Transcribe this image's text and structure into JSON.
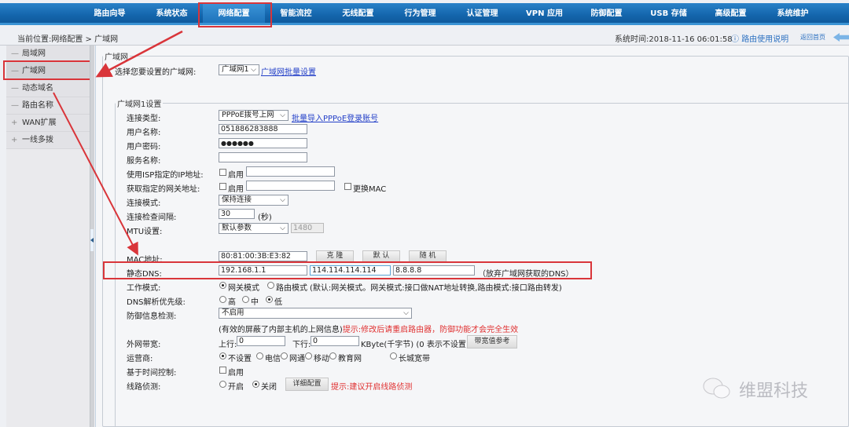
{
  "nav": {
    "items": [
      {
        "label": "路由向导"
      },
      {
        "label": "系统状态"
      },
      {
        "label": "网络配置",
        "active": true
      },
      {
        "label": "智能流控"
      },
      {
        "label": "无线配置"
      },
      {
        "label": "行为管理"
      },
      {
        "label": "认证管理"
      },
      {
        "label": "VPN 应用"
      },
      {
        "label": "防御配置"
      },
      {
        "label": "USB 存储"
      },
      {
        "label": "高级配置"
      },
      {
        "label": "系统维护"
      }
    ]
  },
  "infobar": {
    "breadcrumb": "当前位置:网络配置 > 广域网",
    "system_time": "系统时间:2018-11-16 06:01:58",
    "help_icon": "question-circle-icon",
    "help_link": "路由使用说明",
    "home_link": "返回首页"
  },
  "sidebar": {
    "items": [
      {
        "symbol": "—",
        "label": "局域网"
      },
      {
        "symbol": "—",
        "label": "广域网",
        "selected": true
      },
      {
        "symbol": "—",
        "label": "动态域名"
      },
      {
        "symbol": "—",
        "label": "路由名称"
      },
      {
        "symbol": "+",
        "label": "WAN扩展"
      },
      {
        "symbol": "+",
        "label": "一线多拨"
      }
    ]
  },
  "wan": {
    "legend": "广域网",
    "select_label": "选择您要设置的广域网:",
    "select_value": "广域网1",
    "batch_link": "广域网批量设置"
  },
  "wan1": {
    "legend": "广域网1设置",
    "conn_type": {
      "label": "连接类型:",
      "value": "PPPoE拨号上网",
      "link": "批量导入PPPoE登录账号"
    },
    "username": {
      "label": "用户名称:",
      "value": "051886283888"
    },
    "password": {
      "label": "用户密码:",
      "value": "●●●●●●"
    },
    "service": {
      "label": "服务名称:",
      "value": ""
    },
    "isp_ip": {
      "label": "使用ISP指定的IP地址:",
      "checkbox_label": "启用",
      "checked": false,
      "value": ""
    },
    "gateway": {
      "label": "获取指定的网关地址:",
      "checkbox_label": "启用",
      "checked": false,
      "value": "",
      "mac_checkbox_label": "更换MAC",
      "mac_checked": false
    },
    "conn_mode": {
      "label": "连接模式:",
      "value": "保持连接"
    },
    "check_interval": {
      "label": "连接检查间隔:",
      "value": "30",
      "unit": "(秒)"
    },
    "mtu": {
      "label": "MTU设置:",
      "value": "默认参数",
      "number": "1480"
    },
    "mac": {
      "label": "MAC地址:",
      "value": "80:81:00:3B:E3:82",
      "buttons": [
        "克 隆",
        "默 认",
        "随 机"
      ]
    },
    "dns": {
      "label": "静态DNS:",
      "values": [
        "192.168.1.1",
        "114.114.114.114",
        "8.8.8.8"
      ],
      "note": "（放弃广域网获取的DNS）"
    },
    "work_mode": {
      "label": "工作模式:",
      "options": [
        "网关模式",
        "路由模式"
      ],
      "selected": 0,
      "note": "(默认:网关模式。网关模式:接口做NAT地址转换,路由模式:接口路由转发)"
    },
    "dns_priority": {
      "label": "DNS解析优先级:",
      "options": [
        "高",
        "中",
        "低"
      ],
      "selected": 2
    },
    "defense": {
      "label": "防御信息检测:",
      "value": "不启用",
      "note": "(有效的屏蔽了内部主机的上网信息)",
      "warning": "提示:修改后请重启路由器，防御功能才会完全生效"
    },
    "bandwidth": {
      "label": "外网带宽:",
      "up_label": "上行:",
      "up_value": "0",
      "down_label": "下行:",
      "down_value": "0",
      "unit": "KByte(千字节) (0 表示不设置)",
      "button": "带宽值参考"
    },
    "isp": {
      "label": "运营商:",
      "options": [
        "不设置",
        "电信",
        "网通",
        "移动",
        "教育网",
        "长城宽带"
      ],
      "selected": 0
    },
    "time_control": {
      "label": "基于时间控制:",
      "checkbox_label": "启用",
      "checked": false
    },
    "line_detect": {
      "label": "线路侦测:",
      "options": [
        "开启",
        "关闭"
      ],
      "selected": 1,
      "button": "详细配置",
      "warning": "提示:建议开启线路侦测"
    }
  },
  "watermark": {
    "icon": "wechat-icon",
    "text": "维盟科技"
  },
  "colors": {
    "nav_blue": "#1466ad",
    "highlight_red": "#d9353a",
    "link_blue": "#2440c8",
    "warning_red": "#e03030"
  }
}
